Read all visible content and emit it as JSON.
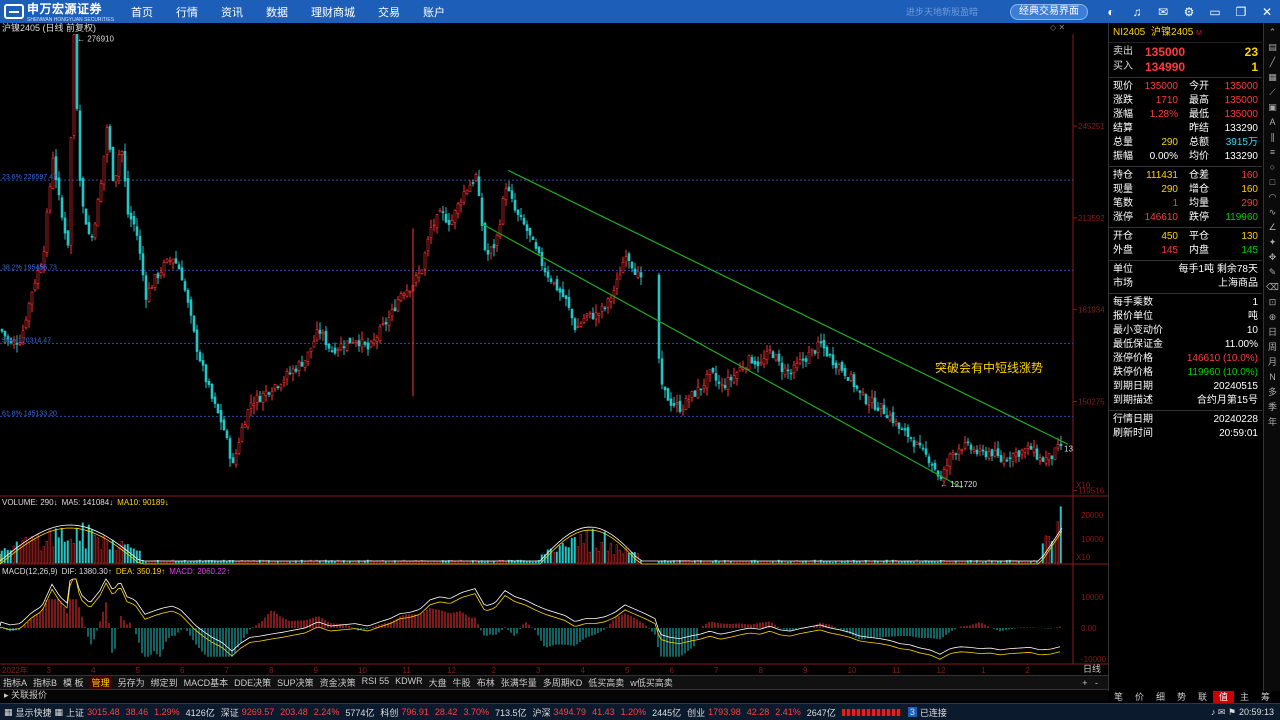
{
  "brand": {
    "name": "申万宏源证券",
    "sub": "SHENWAN HONGYUAN SECURITIES"
  },
  "nav": [
    "首页",
    "行情",
    "资讯",
    "数据",
    "理财商城",
    "交易",
    "账户"
  ],
  "top_right": {
    "faint": "进步天地新股盈暗",
    "classic_button": "经典交易界面"
  },
  "chart_header": "沪镍2405 (日线 前复权)",
  "chart_data": [
    {
      "type": "candlestick",
      "title": "沪镍2405 (日线 前复权)",
      "price_ticks": [
        245251,
        213592,
        181934,
        150275,
        119516
      ],
      "price_range": [
        118000,
        277000
      ],
      "max_label": "276910",
      "min_label": "121720",
      "last_marker": "13",
      "fib_levels": [
        {
          "label": "23.6% 226597.47",
          "value": 226597
        },
        {
          "label": "38.2% 195455.73",
          "value": 195456
        },
        {
          "label": "50% 170314.47",
          "value": 170314
        },
        {
          "label": "61.8% 145133.20",
          "value": 145133
        }
      ],
      "annotation": "突破会有中短线涨势",
      "x_labels": [
        "2022年",
        "3",
        "4",
        "5",
        "6",
        "7",
        "8",
        "9",
        "10",
        "11",
        "12",
        "2",
        "3",
        "4",
        "5",
        "6",
        "7",
        "8",
        "9",
        "10",
        "11",
        "12",
        "1",
        "2"
      ],
      "close_path": [
        [
          0,
          175000
        ],
        [
          10,
          170000
        ],
        [
          20,
          172000
        ],
        [
          32,
          190000
        ],
        [
          42,
          200000
        ],
        [
          52,
          235000
        ],
        [
          60,
          215000
        ],
        [
          67,
          205000
        ],
        [
          73,
          276910
        ],
        [
          80,
          220000
        ],
        [
          90,
          205000
        ],
        [
          100,
          225000
        ],
        [
          106,
          245000
        ],
        [
          113,
          225000
        ],
        [
          120,
          240000
        ],
        [
          127,
          215000
        ],
        [
          135,
          210000
        ],
        [
          145,
          187000
        ],
        [
          155,
          193000
        ],
        [
          163,
          197000
        ],
        [
          172,
          200000
        ],
        [
          180,
          195000
        ],
        [
          188,
          182000
        ],
        [
          195,
          170000
        ],
        [
          203,
          160000
        ],
        [
          212,
          150000
        ],
        [
          222,
          142000
        ],
        [
          232,
          128000
        ],
        [
          240,
          140000
        ],
        [
          250,
          150000
        ],
        [
          260,
          152000
        ],
        [
          270,
          155000
        ],
        [
          282,
          158000
        ],
        [
          295,
          162000
        ],
        [
          305,
          165000
        ],
        [
          318,
          175000
        ],
        [
          330,
          168000
        ],
        [
          342,
          170000
        ],
        [
          355,
          172000
        ],
        [
          368,
          168000
        ],
        [
          380,
          175000
        ],
        [
          390,
          180000
        ],
        [
          400,
          188000
        ],
        [
          410,
          190000
        ],
        [
          420,
          195000
        ],
        [
          430,
          210000
        ],
        [
          440,
          215000
        ],
        [
          450,
          212000
        ],
        [
          462,
          222000
        ],
        [
          475,
          228000
        ],
        [
          485,
          200000
        ],
        [
          495,
          205000
        ],
        [
          505,
          225000
        ],
        [
          515,
          215000
        ],
        [
          525,
          210000
        ],
        [
          535,
          202000
        ],
        [
          545,
          195000
        ],
        [
          555,
          190000
        ],
        [
          565,
          185000
        ],
        [
          575,
          175000
        ],
        [
          585,
          180000
        ],
        [
          595,
          180000
        ],
        [
          605,
          183000
        ],
        [
          615,
          190000
        ],
        [
          625,
          202000
        ],
        [
          635,
          195000
        ],
        [
          645,
          188000
        ],
        [
          655,
          180000
        ],
        [
          660,
          155000
        ],
        [
          670,
          150000
        ],
        [
          680,
          148000
        ],
        [
          690,
          152000
        ],
        [
          700,
          155000
        ],
        [
          710,
          160000
        ],
        [
          720,
          155000
        ],
        [
          730,
          158000
        ],
        [
          740,
          162000
        ],
        [
          750,
          165000
        ],
        [
          760,
          163000
        ],
        [
          770,
          168000
        ],
        [
          780,
          162000
        ],
        [
          790,
          160000
        ],
        [
          800,
          164000
        ],
        [
          810,
          167000
        ],
        [
          820,
          170000
        ],
        [
          830,
          165000
        ],
        [
          840,
          162000
        ],
        [
          850,
          158000
        ],
        [
          860,
          152000
        ],
        [
          870,
          150000
        ],
        [
          880,
          148000
        ],
        [
          890,
          145000
        ],
        [
          900,
          140000
        ],
        [
          910,
          138000
        ],
        [
          920,
          133000
        ],
        [
          930,
          130000
        ],
        [
          940,
          123000
        ],
        [
          950,
          132000
        ],
        [
          960,
          135000
        ],
        [
          970,
          134000
        ],
        [
          980,
          132000
        ],
        [
          990,
          133000
        ],
        [
          1000,
          130000
        ],
        [
          1010,
          132000
        ],
        [
          1020,
          133000
        ],
        [
          1030,
          134000
        ],
        [
          1040,
          130000
        ],
        [
          1050,
          131000
        ],
        [
          1060,
          135000
        ]
      ],
      "channel_upper": [
        [
          508,
          230000
        ],
        [
          1068,
          135500
        ]
      ],
      "channel_lower": [
        [
          482,
          211500
        ],
        [
          962,
          120500
        ]
      ]
    },
    {
      "type": "bar",
      "title": "VOLUME: 290↓  MA5: 141084↓  MA10: 90189↓",
      "ticks": [
        20000,
        10000
      ],
      "unit_label": "X10"
    },
    {
      "type": "bar",
      "title": "MACD(12,26,9)  DIF: 1380.30↑  DEA: 350.19↑  MACD: 2060.22↑",
      "ticks": [
        10000,
        0.0,
        -10000
      ],
      "tick_labels": [
        "10000",
        "0.00",
        "-10000"
      ]
    }
  ],
  "volume_header": {
    "name": "VOLUME: 290↓",
    "ma5": "MA5: 141084↓",
    "ma10": "MA10: 90189↓"
  },
  "macd_header": {
    "name": "MACD(12,26,9)",
    "dif": "DIF: 1380.30↑",
    "dea": "DEA: 350.19↑",
    "macd": "MACD: 2060.22↑"
  },
  "quote": {
    "code": "NI2405",
    "name": "沪镍2405",
    "badge": "M",
    "sell": {
      "label": "卖出",
      "price": "135000",
      "qty": "23"
    },
    "buy": {
      "label": "买入",
      "price": "134990",
      "qty": "1"
    },
    "rows1": [
      [
        "现价",
        "135000",
        "今开",
        "135000"
      ],
      [
        "涨跌",
        "1710",
        "最高",
        "135000"
      ],
      [
        "涨幅",
        "1.28%",
        "最低",
        "135000"
      ],
      [
        "结算",
        "",
        "昨结",
        "133290"
      ],
      [
        "总量",
        "290",
        "总额",
        "3915万"
      ],
      [
        "振幅",
        "0.00%",
        "均价",
        "133290"
      ]
    ],
    "rows2": [
      [
        "持仓",
        "111431",
        "仓差",
        "160"
      ],
      [
        "现量",
        "290",
        "增仓",
        "160"
      ],
      [
        "笔数",
        "1",
        "均量",
        "290"
      ],
      [
        "涨停",
        "146610",
        "跌停",
        "119960"
      ]
    ],
    "rows3": [
      [
        "开仓",
        "450",
        "平仓",
        "130"
      ],
      [
        "外盘",
        "145",
        "内盘",
        "145"
      ]
    ],
    "rows4": [
      [
        "单位",
        "每手1吨  剩余78天"
      ],
      [
        "市场",
        "上海商品"
      ]
    ],
    "rows5": [
      [
        "每手乘数",
        "1"
      ],
      [
        "报价单位",
        "吨"
      ],
      [
        "最小变动价",
        "10"
      ],
      [
        "最低保证金",
        "11.00%"
      ],
      [
        "涨停价格",
        "146610 (10.0%)"
      ],
      [
        "跌停价格",
        "119960 (10.0%)"
      ],
      [
        "到期日期",
        "20240515"
      ],
      [
        "到期描述",
        "合约月第15号"
      ]
    ],
    "rows6": [
      [
        "行情日期",
        "20240228"
      ],
      [
        "刷新时间",
        "20:59:01"
      ]
    ]
  },
  "right_tools": [
    "日",
    "周",
    "月",
    "N",
    "多",
    "季",
    "年"
  ],
  "bottom_tabs": [
    "指标A",
    "指标B",
    "模 板",
    "管理",
    "另存为",
    "绑定到",
    "MACD基本",
    "DDE决策",
    "SUP决策",
    "资金决策",
    "RSI 55",
    "KDWR",
    "大盘",
    "牛股",
    "布林",
    "张满华量",
    "多周期KD",
    "低买高卖",
    "w低买高卖"
  ],
  "bottom_active": "管理",
  "dayline": "日线",
  "linked": "关联报价",
  "right_tabs": [
    "笔",
    "价",
    "细",
    "势",
    "联",
    "值",
    "主",
    "筹"
  ],
  "right_tabs_active": "值",
  "status": {
    "label": "显示快捷",
    "sh": {
      "name": "上证",
      "val": "3015.48",
      "chg": "38.46",
      "pct": "1.29%",
      "amt": "4126亿"
    },
    "sz": {
      "name": "深证",
      "val": "9269.57",
      "chg": "203.48",
      "pct": "2.24%",
      "amt": "5774亿"
    },
    "kc": {
      "name": "科创",
      "val": "796.91",
      "chg": "28.42",
      "pct": "3.70%",
      "amt": "713.5亿"
    },
    "hs": {
      "name": "沪深",
      "val": "3494.79",
      "chg": "41.43",
      "pct": "1.20%",
      "amt": "2445亿"
    },
    "cy": {
      "name": "创业",
      "val": "1793.98",
      "chg": "42.28",
      "pct": "2.41%",
      "amt": "2647亿"
    },
    "conn": "已连接",
    "count": "3",
    "time": "20:59:13"
  }
}
